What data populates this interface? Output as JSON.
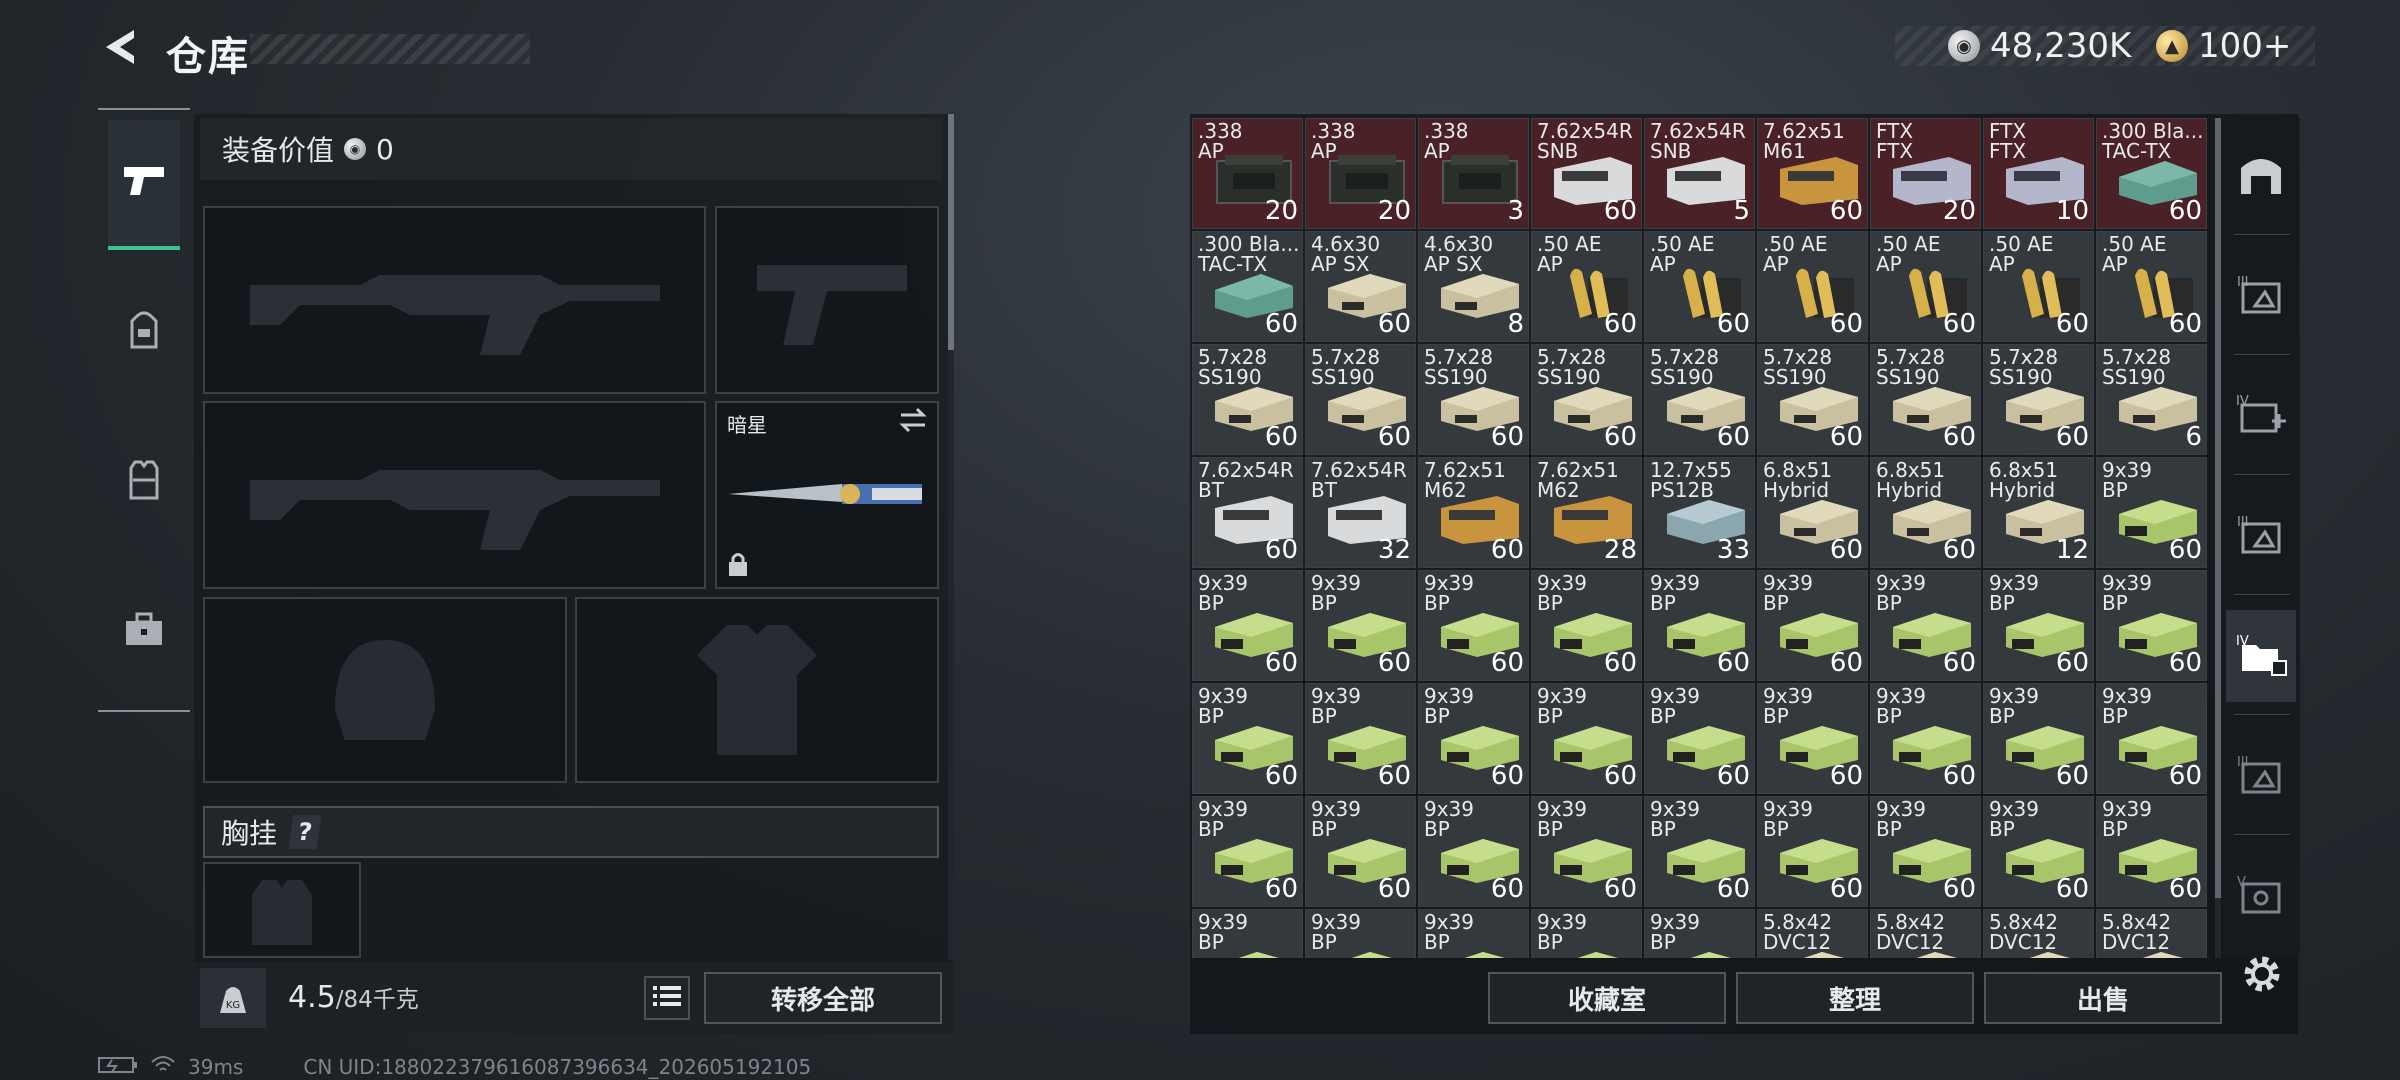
{
  "header": {
    "title": "仓库",
    "silver_amount": "48,230K",
    "gold_amount": "100+"
  },
  "loadout": {
    "value_label": "装备价值",
    "value": "0",
    "knife_name": "暗星",
    "chest_rig_label": "胸挂",
    "chest_rig_help": "?",
    "weight_current": "4.5",
    "weight_max": "/84千克",
    "kg_label": "KG",
    "transfer_all_label": "转移全部"
  },
  "stash": {
    "items": [
      {
        "name": ".338\nAP",
        "count": "20",
        "bg": "red",
        "art": "ammo-can"
      },
      {
        "name": ".338\nAP",
        "count": "20",
        "bg": "red",
        "art": "ammo-can"
      },
      {
        "name": ".338\nAP",
        "count": "3",
        "bg": "red",
        "art": "ammo-can"
      },
      {
        "name": "7.62x54R\nSNB",
        "count": "60",
        "bg": "red",
        "art": "box-white"
      },
      {
        "name": "7.62x54R\nSNB",
        "count": "5",
        "bg": "red",
        "art": "box-white"
      },
      {
        "name": "7.62x51\nM61",
        "count": "60",
        "bg": "red",
        "art": "box-orange"
      },
      {
        "name": "FTX\nFTX",
        "count": "20",
        "bg": "red",
        "art": "box-lavender"
      },
      {
        "name": "FTX\nFTX",
        "count": "10",
        "bg": "red",
        "art": "box-lavender"
      },
      {
        "name": ".300 Bla...\nTAC-TX",
        "count": "60",
        "bg": "red",
        "art": "box-teal"
      },
      {
        "name": ".300 Bla...\nTAC-TX",
        "count": "60",
        "bg": "gray",
        "art": "box-teal"
      },
      {
        "name": "4.6x30\nAP SX",
        "count": "60",
        "bg": "gray",
        "art": "box-tan"
      },
      {
        "name": "4.6x30\nAP SX",
        "count": "8",
        "bg": "gray",
        "art": "box-tan"
      },
      {
        "name": ".50 AE\nAP",
        "count": "60",
        "bg": "gray",
        "art": "cartridge"
      },
      {
        "name": ".50 AE\nAP",
        "count": "60",
        "bg": "gray",
        "art": "cartridge"
      },
      {
        "name": ".50 AE\nAP",
        "count": "60",
        "bg": "gray",
        "art": "cartridge"
      },
      {
        "name": ".50 AE\nAP",
        "count": "60",
        "bg": "gray",
        "art": "cartridge"
      },
      {
        "name": ".50 AE\nAP",
        "count": "60",
        "bg": "gray",
        "art": "cartridge"
      },
      {
        "name": ".50 AE\nAP",
        "count": "60",
        "bg": "gray",
        "art": "cartridge"
      },
      {
        "name": "5.7x28\nSS190",
        "count": "60",
        "bg": "gray",
        "art": "box-tan"
      },
      {
        "name": "5.7x28\nSS190",
        "count": "60",
        "bg": "gray",
        "art": "box-tan"
      },
      {
        "name": "5.7x28\nSS190",
        "count": "60",
        "bg": "gray",
        "art": "box-tan"
      },
      {
        "name": "5.7x28\nSS190",
        "count": "60",
        "bg": "gray",
        "art": "box-tan"
      },
      {
        "name": "5.7x28\nSS190",
        "count": "60",
        "bg": "gray",
        "art": "box-tan"
      },
      {
        "name": "5.7x28\nSS190",
        "count": "60",
        "bg": "gray",
        "art": "box-tan"
      },
      {
        "name": "5.7x28\nSS190",
        "count": "60",
        "bg": "gray",
        "art": "box-tan"
      },
      {
        "name": "5.7x28\nSS190",
        "count": "60",
        "bg": "gray",
        "art": "box-tan"
      },
      {
        "name": "5.7x28\nSS190",
        "count": "6",
        "bg": "gray",
        "art": "box-tan"
      },
      {
        "name": "7.62x54R\nBT",
        "count": "60",
        "bg": "gray",
        "art": "box-white"
      },
      {
        "name": "7.62x54R\nBT",
        "count": "32",
        "bg": "gray",
        "art": "box-white"
      },
      {
        "name": "7.62x51\nM62",
        "count": "60",
        "bg": "gray",
        "art": "box-orange"
      },
      {
        "name": "7.62x51\nM62",
        "count": "28",
        "bg": "gray",
        "art": "box-orange"
      },
      {
        "name": "12.7x55\nPS12B",
        "count": "33",
        "bg": "gray",
        "art": "box-blue"
      },
      {
        "name": "6.8x51\nHybrid",
        "count": "60",
        "bg": "gray",
        "art": "box-tan"
      },
      {
        "name": "6.8x51\nHybrid",
        "count": "60",
        "bg": "gray",
        "art": "box-tan"
      },
      {
        "name": "6.8x51\nHybrid",
        "count": "12",
        "bg": "gray",
        "art": "box-tan"
      },
      {
        "name": "9x39\nBP",
        "count": "60",
        "bg": "gray",
        "art": "box-green"
      },
      {
        "name": "9x39\nBP",
        "count": "60",
        "bg": "gray",
        "art": "box-green"
      },
      {
        "name": "9x39\nBP",
        "count": "60",
        "bg": "gray",
        "art": "box-green"
      },
      {
        "name": "9x39\nBP",
        "count": "60",
        "bg": "gray",
        "art": "box-green"
      },
      {
        "name": "9x39\nBP",
        "count": "60",
        "bg": "gray",
        "art": "box-green"
      },
      {
        "name": "9x39\nBP",
        "count": "60",
        "bg": "gray",
        "art": "box-green"
      },
      {
        "name": "9x39\nBP",
        "count": "60",
        "bg": "gray",
        "art": "box-green"
      },
      {
        "name": "9x39\nBP",
        "count": "60",
        "bg": "gray",
        "art": "box-green"
      },
      {
        "name": "9x39\nBP",
        "count": "60",
        "bg": "gray",
        "art": "box-green"
      },
      {
        "name": "9x39\nBP",
        "count": "60",
        "bg": "gray",
        "art": "box-green"
      },
      {
        "name": "9x39\nBP",
        "count": "60",
        "bg": "gray",
        "art": "box-green"
      },
      {
        "name": "9x39\nBP",
        "count": "60",
        "bg": "gray",
        "art": "box-green"
      },
      {
        "name": "9x39\nBP",
        "count": "60",
        "bg": "gray",
        "art": "box-green"
      },
      {
        "name": "9x39\nBP",
        "count": "60",
        "bg": "gray",
        "art": "box-green"
      },
      {
        "name": "9x39\nBP",
        "count": "60",
        "bg": "gray",
        "art": "box-green"
      },
      {
        "name": "9x39\nBP",
        "count": "60",
        "bg": "gray",
        "art": "box-green"
      },
      {
        "name": "9x39\nBP",
        "count": "60",
        "bg": "gray",
        "art": "box-green"
      },
      {
        "name": "9x39\nBP",
        "count": "60",
        "bg": "gray",
        "art": "box-green"
      },
      {
        "name": "9x39\nBP",
        "count": "60",
        "bg": "gray",
        "art": "box-green"
      },
      {
        "name": "9x39\nBP",
        "count": "60",
        "bg": "gray",
        "art": "box-green"
      },
      {
        "name": "9x39\nBP",
        "count": "60",
        "bg": "gray",
        "art": "box-green"
      },
      {
        "name": "9x39\nBP",
        "count": "60",
        "bg": "gray",
        "art": "box-green"
      },
      {
        "name": "9x39\nBP",
        "count": "60",
        "bg": "gray",
        "art": "box-green"
      },
      {
        "name": "9x39\nBP",
        "count": "60",
        "bg": "gray",
        "art": "box-green"
      },
      {
        "name": "9x39\nBP",
        "count": "60",
        "bg": "gray",
        "art": "box-green"
      },
      {
        "name": "9x39\nBP",
        "count": "60",
        "bg": "gray",
        "art": "box-green"
      },
      {
        "name": "9x39\nBP",
        "count": "60",
        "bg": "gray",
        "art": "box-green"
      },
      {
        "name": "9x39\nBP",
        "count": "60",
        "bg": "gray",
        "art": "box-green"
      },
      {
        "name": "9x39\nBP",
        "count": "",
        "bg": "gray",
        "art": "box-green"
      },
      {
        "name": "9x39\nBP",
        "count": "",
        "bg": "gray",
        "art": "box-green"
      },
      {
        "name": "9x39\nBP",
        "count": "",
        "bg": "gray",
        "art": "box-green"
      },
      {
        "name": "9x39\nBP",
        "count": "",
        "bg": "gray",
        "art": "box-green"
      },
      {
        "name": "9x39\nBP",
        "count": "",
        "bg": "gray",
        "art": "box-green"
      },
      {
        "name": "5.8x42\nDVC12",
        "count": "",
        "bg": "gray",
        "art": "box-tan"
      },
      {
        "name": "5.8x42\nDVC12",
        "count": "",
        "bg": "gray",
        "art": "box-tan"
      },
      {
        "name": "5.8x42\nDVC12",
        "count": "",
        "bg": "gray",
        "art": "box-tan"
      },
      {
        "name": "5.8x42\nDVC12",
        "count": "",
        "bg": "gray",
        "art": "box-tan"
      }
    ],
    "collection_label": "收藏室",
    "sort_label": "整理",
    "sell_label": "出售"
  },
  "status": {
    "ping": "39ms",
    "uid": "CN UID:188022379616087396634_202605192105"
  },
  "colors": {
    "accent_green": "#3ec38a",
    "cell_red": "#4a2126",
    "cell_gray": "#34393d"
  }
}
